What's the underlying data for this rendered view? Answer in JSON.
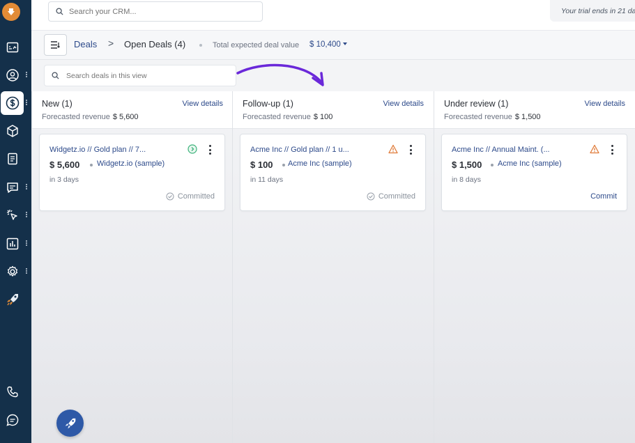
{
  "topbar": {
    "search_placeholder": "Search your CRM...",
    "trial_text": "Your trial ends in 21 da"
  },
  "breadcrumb": {
    "root": "Deals",
    "separator": ">",
    "current": "Open Deals",
    "count": "(4)"
  },
  "summary": {
    "total_label": "Total expected deal value",
    "total_value": "$ 10,400"
  },
  "deal_search": {
    "placeholder": "Search deals in this view"
  },
  "columns": [
    {
      "title": "New (1)",
      "view_label": "View details",
      "forecast_label": "Forecasted revenue",
      "forecast_value": "$ 5,600",
      "card": {
        "title": "Widgetz.io // Gold plan // 7...",
        "amount": "$ 5,600",
        "company": "Widgetz.io (sample)",
        "days": "in 3 days",
        "action": "Committed",
        "status_icon": "check-circle-icon"
      }
    },
    {
      "title": "Follow-up (1)",
      "view_label": "View details",
      "forecast_label": "Forecasted revenue",
      "forecast_value": "$ 100",
      "card": {
        "title": "Acme Inc // Gold plan // 1 u...",
        "amount": "$ 100",
        "company": "Acme Inc (sample)",
        "days": "in 11 days",
        "action": "Committed",
        "status_icon": "warning-icon"
      }
    },
    {
      "title": "Under review (1)",
      "view_label": "View details",
      "forecast_label": "Forecasted revenue",
      "forecast_value": "$ 1,500",
      "card": {
        "title": "Acme Inc // Annual Maint. (...",
        "amount": "$ 1,500",
        "company": "Acme Inc (sample)",
        "days": "in 8 days",
        "action": "Commit",
        "status_icon": "warning-icon"
      }
    }
  ],
  "colors": {
    "sidebar": "#14304a",
    "accent": "#2d4a8a",
    "brand": "#e28b36",
    "warning": "#e07b39",
    "success": "#3bb27a",
    "annotation_arrow": "#6a28d9"
  }
}
